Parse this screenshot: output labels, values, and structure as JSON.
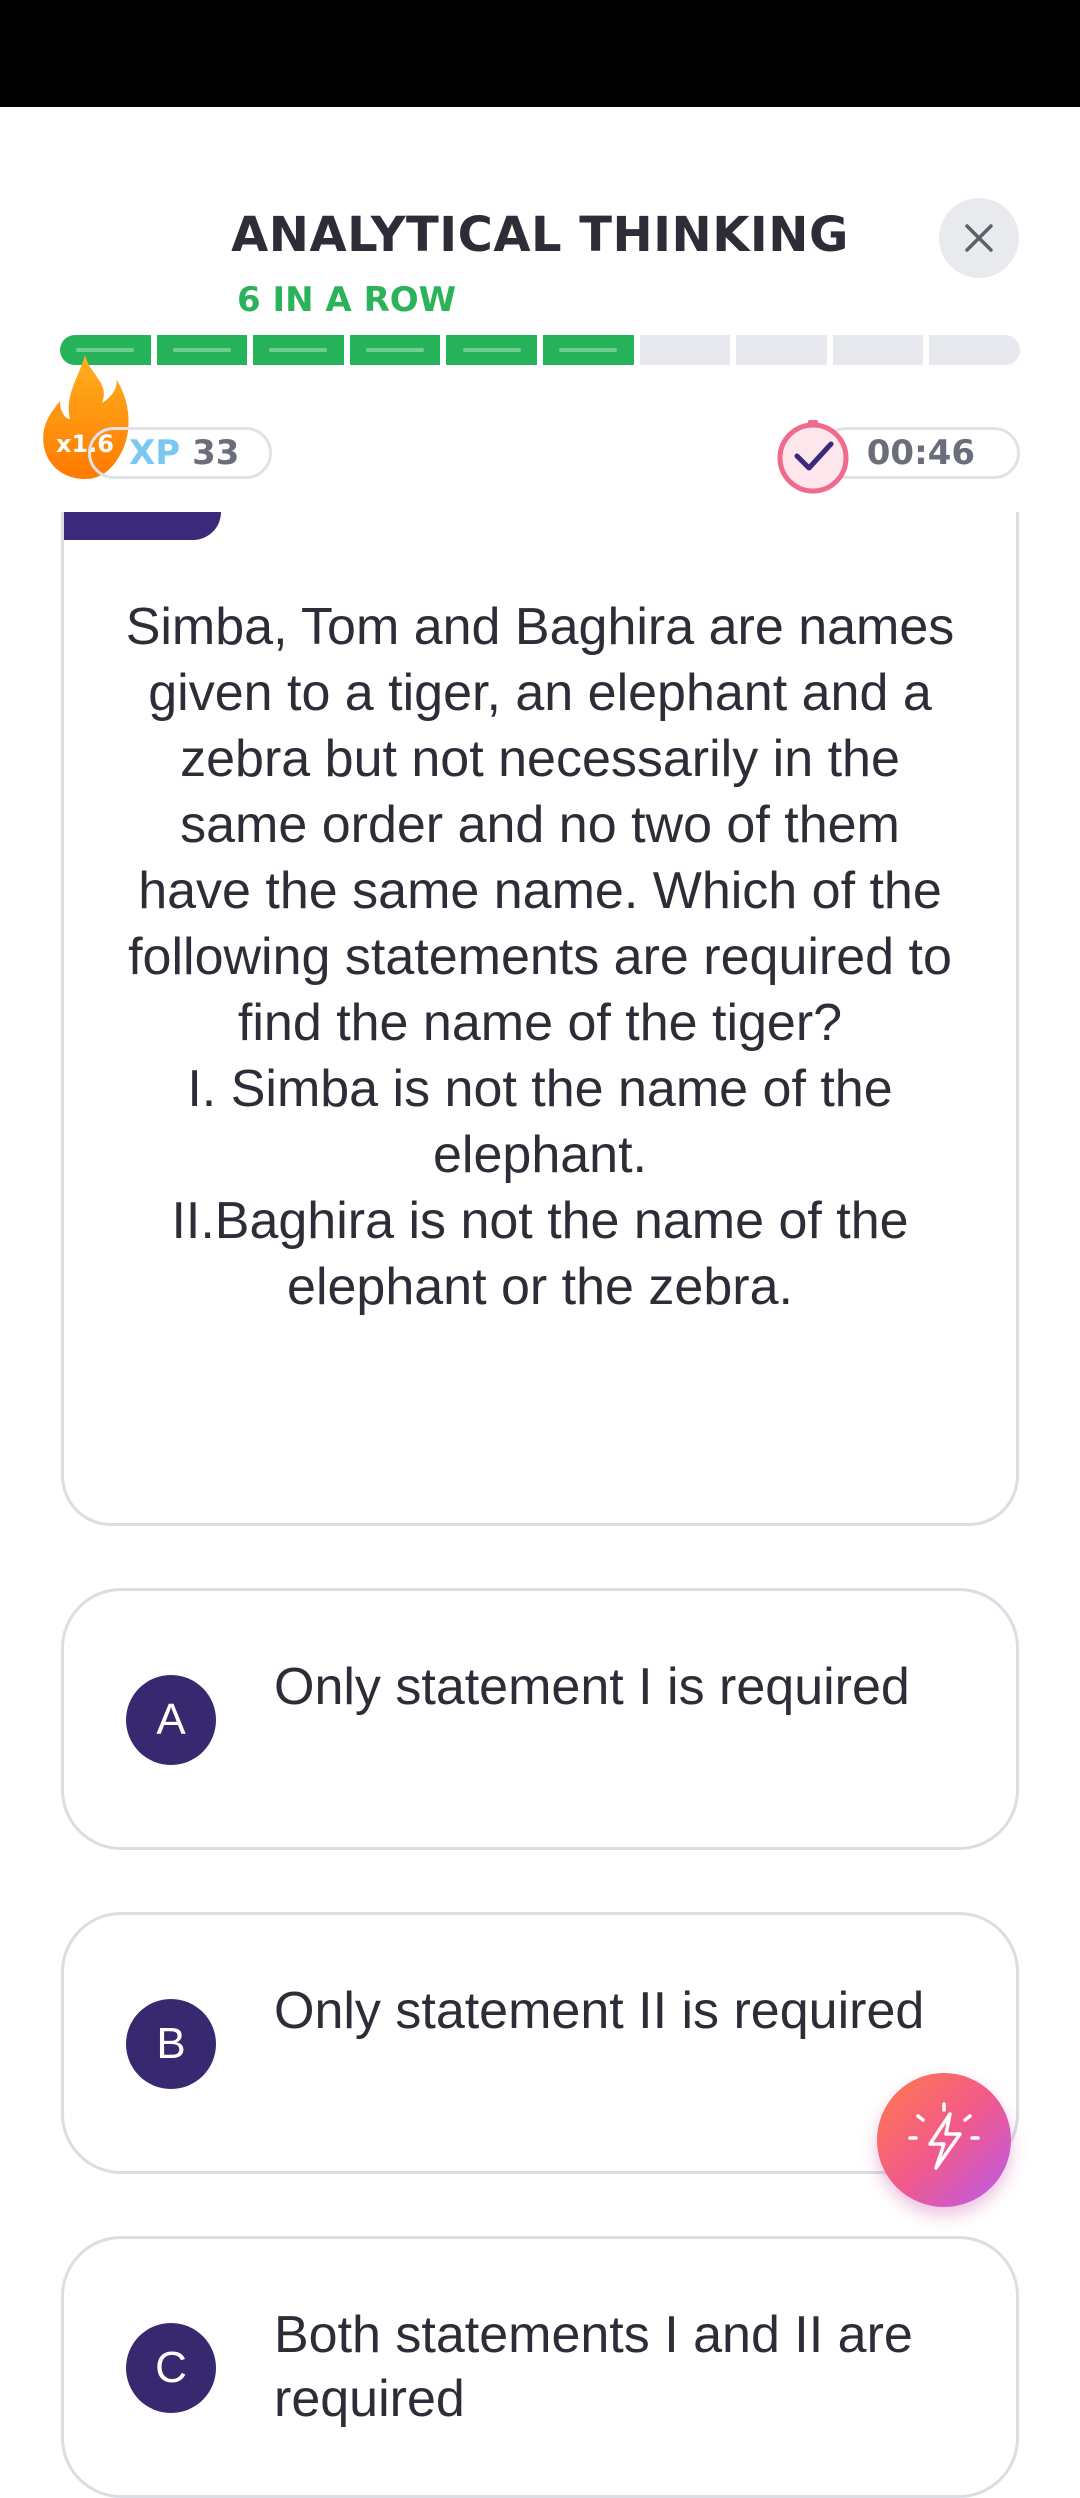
{
  "header": {
    "title": "ANALYTICAL THINKING",
    "streak": "6 IN A ROW",
    "close_icon": "close-icon"
  },
  "progress": {
    "filled_segments": 6,
    "total_segments": 10,
    "color": "#27b35a"
  },
  "stats": {
    "multiplier": "x1.6",
    "xp_label": "XP",
    "xp_value": "33",
    "timer": "00:46"
  },
  "question": {
    "lines": [
      "Simba, Tom and Baghira are names given to a tiger, an elephant and a zebra but not necessarily in the same order and no two of them have the same name. Which of the following statements are required to find the name of the tiger?",
      "I. Simba is not the name of the elephant.",
      "II.Baghira is not the name of the elephant or the zebra."
    ]
  },
  "options": [
    {
      "letter": "A",
      "text": "Only statement I is required"
    },
    {
      "letter": "B",
      "text": "Only statement II is required"
    },
    {
      "letter": "C",
      "text": "Both statements I and II are required"
    }
  ],
  "colors": {
    "accent": "#38286f",
    "success": "#27b35a",
    "xp": "#79c8f3"
  }
}
